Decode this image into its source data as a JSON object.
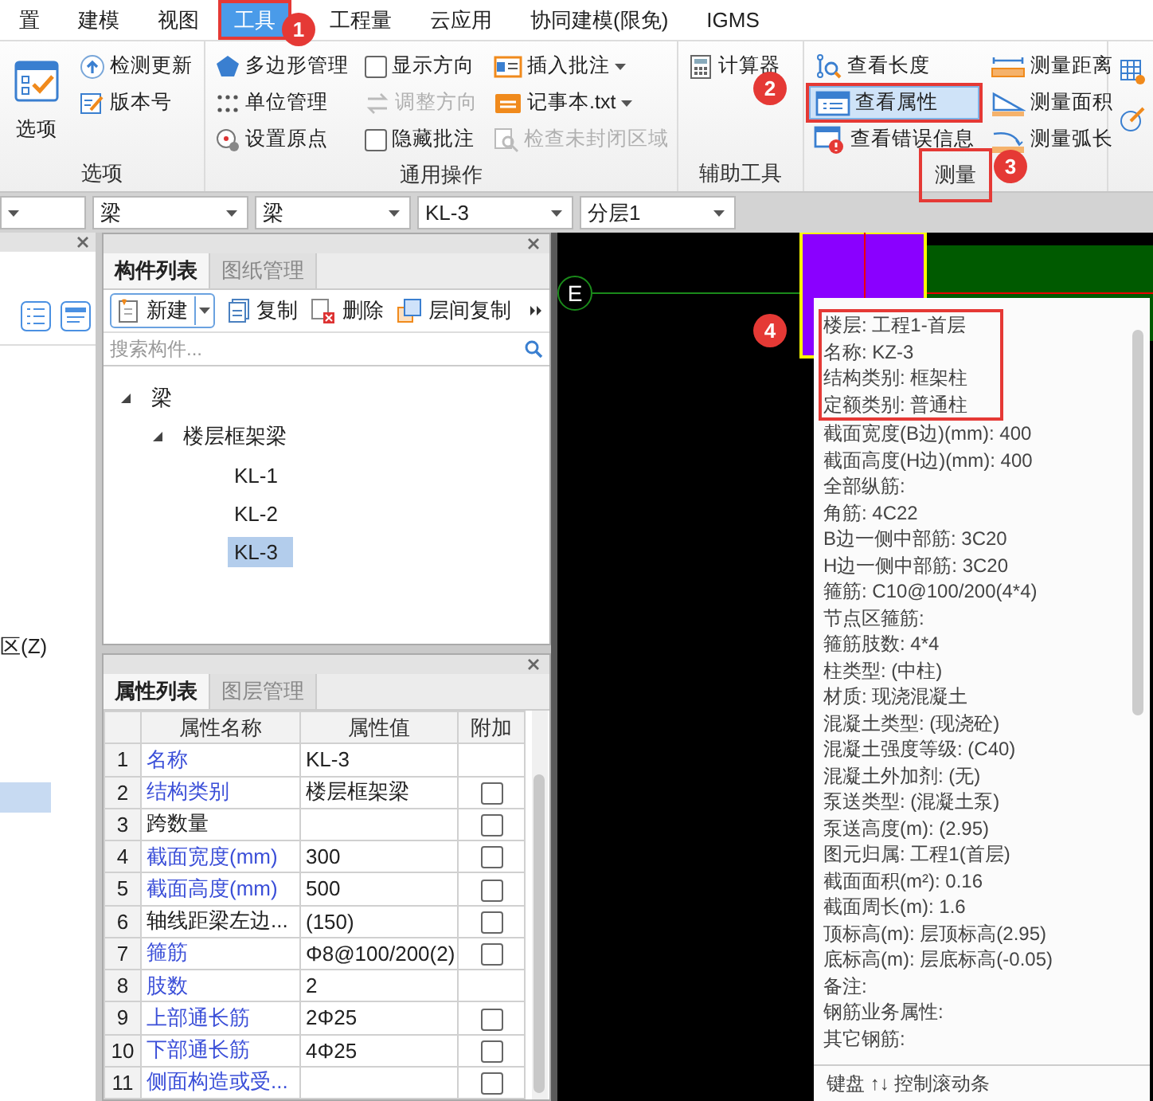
{
  "menu": [
    {
      "label": "置",
      "selected": false
    },
    {
      "label": "建模",
      "selected": false
    },
    {
      "label": "视图",
      "selected": false
    },
    {
      "label": "工具",
      "selected": true
    },
    {
      "label": "工程量",
      "selected": false
    },
    {
      "label": "云应用",
      "selected": false
    },
    {
      "label": "协同建模(限免)",
      "selected": false
    },
    {
      "label": "IGMS",
      "selected": false
    }
  ],
  "ribbon": {
    "groups": [
      {
        "title": "选项",
        "highlighted": false,
        "columns": [
          {
            "items": [
              {
                "kind": "large",
                "label": "选项",
                "disabled": false,
                "highlighted": false
              }
            ]
          },
          {
            "items": [
              {
                "kind": "button",
                "label": "检测更新",
                "disabled": false,
                "highlighted": false
              },
              {
                "kind": "button",
                "label": "版本号",
                "disabled": false,
                "highlighted": false
              }
            ]
          }
        ]
      },
      {
        "title": "通用操作",
        "highlighted": false,
        "columns": [
          {
            "items": [
              {
                "kind": "button",
                "label": "多边形管理",
                "disabled": false,
                "highlighted": false
              },
              {
                "kind": "button",
                "label": "单位管理",
                "disabled": false,
                "highlighted": false
              },
              {
                "kind": "button",
                "label": "设置原点",
                "disabled": false,
                "highlighted": false
              }
            ]
          },
          {
            "items": [
              {
                "kind": "checkbox",
                "label": "显示方向",
                "checked": false,
                "disabled": false,
                "highlighted": false
              },
              {
                "kind": "button",
                "label": "调整方向",
                "disabled": true,
                "highlighted": false
              },
              {
                "kind": "checkbox",
                "label": "隐藏批注",
                "checked": false,
                "disabled": false,
                "highlighted": false
              }
            ]
          },
          {
            "items": [
              {
                "kind": "dropdown",
                "label": "插入批注",
                "disabled": false,
                "highlighted": false
              },
              {
                "kind": "dropdown",
                "label": "记事本.txt",
                "disabled": false,
                "highlighted": false
              },
              {
                "kind": "button",
                "label": "检查未封闭区域",
                "disabled": true,
                "highlighted": false
              }
            ]
          }
        ]
      },
      {
        "title": "辅助工具",
        "highlighted": false,
        "columns": [
          {
            "items": [
              {
                "kind": "button",
                "label": "计算器",
                "disabled": false,
                "highlighted": false
              }
            ]
          }
        ]
      },
      {
        "title": "测量",
        "highlighted": true,
        "columns": [
          {
            "items": [
              {
                "kind": "button",
                "label": "查看长度",
                "disabled": false,
                "highlighted": false
              },
              {
                "kind": "button",
                "label": "查看属性",
                "disabled": false,
                "highlighted": true
              },
              {
                "kind": "button",
                "label": "查看错误信息",
                "disabled": false,
                "highlighted": false
              }
            ]
          },
          {
            "items": [
              {
                "kind": "button",
                "label": "测量距离",
                "disabled": false,
                "highlighted": false
              },
              {
                "kind": "button",
                "label": "测量面积",
                "disabled": false,
                "highlighted": false
              },
              {
                "kind": "button",
                "label": "测量弧长",
                "disabled": false,
                "highlighted": false
              }
            ]
          }
        ]
      }
    ]
  },
  "filters": [
    {
      "value": "梁"
    },
    {
      "value": "梁"
    },
    {
      "value": "KL-3"
    },
    {
      "value": "分层1"
    }
  ],
  "side_panel": {
    "label": "区(Z)"
  },
  "component_panel": {
    "tabs": [
      {
        "label": "构件列表",
        "selected": true
      },
      {
        "label": "图纸管理",
        "selected": false
      }
    ],
    "toolbar": [
      {
        "kind": "split",
        "label": "新建"
      },
      {
        "kind": "button",
        "label": "复制"
      },
      {
        "kind": "button",
        "label": "删除"
      },
      {
        "kind": "button",
        "label": "层间复制"
      }
    ],
    "search": {
      "placeholder": "搜索构件..."
    },
    "tree": [
      {
        "label": "梁",
        "expanded": true,
        "selected": false,
        "children": [
          {
            "label": "楼层框架梁",
            "expanded": true,
            "selected": false,
            "children": [
              {
                "label": "KL-1",
                "selected": false
              },
              {
                "label": "KL-2",
                "selected": false
              },
              {
                "label": "KL-3",
                "selected": true
              }
            ]
          }
        ]
      }
    ]
  },
  "attribute_panel": {
    "tabs": [
      {
        "label": "属性列表",
        "selected": true
      },
      {
        "label": "图层管理",
        "selected": false
      }
    ],
    "columns": [
      "属性名称",
      "属性值",
      "附加"
    ],
    "rows": [
      {
        "index": "1",
        "name": "名称",
        "value": "KL-3",
        "shared": true,
        "kind": "plain"
      },
      {
        "index": "2",
        "name": "结构类别",
        "value": "楼层框架梁",
        "shared": true,
        "kind": "checkbox",
        "checked": false
      },
      {
        "index": "3",
        "name": "跨数量",
        "shared": false,
        "kind": "checkbox",
        "checked": false
      },
      {
        "index": "4",
        "name": "截面宽度(mm)",
        "value": "300",
        "shared": true,
        "kind": "checkbox",
        "checked": false
      },
      {
        "index": "5",
        "name": "截面高度(mm)",
        "value": "500",
        "shared": true,
        "kind": "checkbox",
        "checked": false
      },
      {
        "index": "6",
        "name": "轴线距梁左边...",
        "value": "(150)",
        "shared": false,
        "kind": "checkbox",
        "checked": false
      },
      {
        "index": "7",
        "name": "箍筋",
        "value": "Φ8@100/200(2)",
        "shared": true,
        "kind": "checkbox",
        "checked": false
      },
      {
        "index": "8",
        "name": "肢数",
        "value": "2",
        "shared": true,
        "kind": "plain"
      },
      {
        "index": "9",
        "name": "上部通长筋",
        "value": "2Φ25",
        "shared": true,
        "kind": "checkbox",
        "checked": false
      },
      {
        "index": "10",
        "name": "下部通长筋",
        "value": "4Φ25",
        "shared": true,
        "kind": "checkbox",
        "checked": false
      },
      {
        "index": "11",
        "name": "侧面构造或受...",
        "shared": true,
        "kind": "checkbox",
        "checked": false
      }
    ]
  },
  "drawing": {
    "axis_label": "E",
    "tooltip": {
      "lines": [
        {
          "text": "楼层: 工程1-首层",
          "highlighted": true
        },
        {
          "text": "名称: KZ-3",
          "highlighted": true
        },
        {
          "text": "结构类别: 框架柱",
          "highlighted": true
        },
        {
          "text": "定额类别: 普通柱",
          "highlighted": true
        },
        {
          "text": "截面宽度(B边)(mm): 400",
          "highlighted": false
        },
        {
          "text": "截面高度(H边)(mm): 400",
          "highlighted": false
        },
        {
          "text": "全部纵筋:",
          "highlighted": false
        },
        {
          "text": "角筋: 4C22",
          "highlighted": false
        },
        {
          "text": "B边一侧中部筋: 3C20",
          "highlighted": false
        },
        {
          "text": "H边一侧中部筋: 3C20",
          "highlighted": false
        },
        {
          "text": "箍筋: C10@100/200(4*4)",
          "highlighted": false
        },
        {
          "text": "节点区箍筋:",
          "highlighted": false
        },
        {
          "text": "箍筋肢数: 4*4",
          "highlighted": false
        },
        {
          "text": "柱类型: (中柱)",
          "highlighted": false
        },
        {
          "text": "材质: 现浇混凝土",
          "highlighted": false
        },
        {
          "text": "混凝土类型: (现浇砼)",
          "highlighted": false
        },
        {
          "text": "混凝土强度等级: (C40)",
          "highlighted": false
        },
        {
          "text": "混凝土外加剂: (无)",
          "highlighted": false
        },
        {
          "text": "泵送类型: (混凝土泵)",
          "highlighted": false
        },
        {
          "text": "泵送高度(m): (2.95)",
          "highlighted": false
        },
        {
          "text": "图元归属: 工程1(首层)",
          "highlighted": false
        },
        {
          "text": "截面面积(m²): 0.16",
          "highlighted": false
        },
        {
          "text": "截面周长(m): 1.6",
          "highlighted": false
        },
        {
          "text": "顶标高(m): 层顶标高(2.95)",
          "highlighted": false
        },
        {
          "text": "底标高(m): 层底标高(-0.05)",
          "highlighted": false
        },
        {
          "text": "备注:",
          "highlighted": false
        },
        {
          "text": "钢筋业务属性:",
          "highlighted": false
        },
        {
          "text": "其它钢筋:",
          "highlighted": false
        }
      ],
      "footer": "键盘 ↑↓ 控制滚动条"
    }
  },
  "callouts": [
    "1",
    "2",
    "3",
    "4"
  ]
}
